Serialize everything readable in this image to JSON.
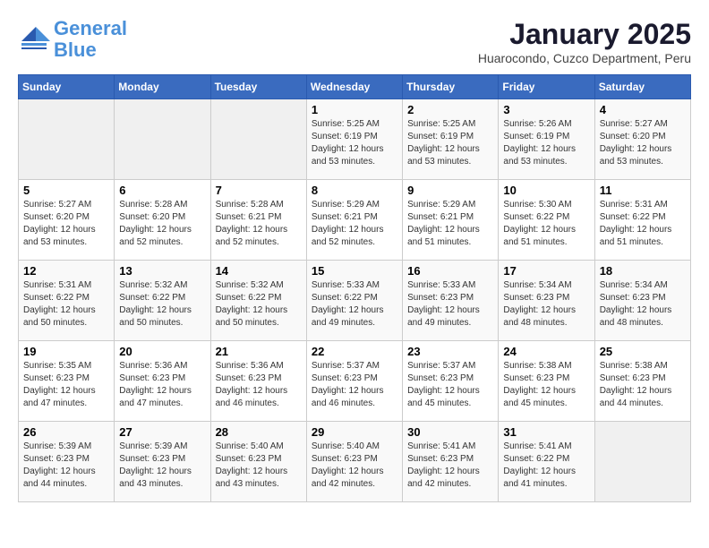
{
  "header": {
    "logo_line1": "General",
    "logo_line2": "Blue",
    "month_title": "January 2025",
    "subtitle": "Huarocondo, Cuzco Department, Peru"
  },
  "days_of_week": [
    "Sunday",
    "Monday",
    "Tuesday",
    "Wednesday",
    "Thursday",
    "Friday",
    "Saturday"
  ],
  "weeks": [
    [
      {
        "num": "",
        "info": ""
      },
      {
        "num": "",
        "info": ""
      },
      {
        "num": "",
        "info": ""
      },
      {
        "num": "1",
        "info": "Sunrise: 5:25 AM\nSunset: 6:19 PM\nDaylight: 12 hours\nand 53 minutes."
      },
      {
        "num": "2",
        "info": "Sunrise: 5:25 AM\nSunset: 6:19 PM\nDaylight: 12 hours\nand 53 minutes."
      },
      {
        "num": "3",
        "info": "Sunrise: 5:26 AM\nSunset: 6:19 PM\nDaylight: 12 hours\nand 53 minutes."
      },
      {
        "num": "4",
        "info": "Sunrise: 5:27 AM\nSunset: 6:20 PM\nDaylight: 12 hours\nand 53 minutes."
      }
    ],
    [
      {
        "num": "5",
        "info": "Sunrise: 5:27 AM\nSunset: 6:20 PM\nDaylight: 12 hours\nand 53 minutes."
      },
      {
        "num": "6",
        "info": "Sunrise: 5:28 AM\nSunset: 6:20 PM\nDaylight: 12 hours\nand 52 minutes."
      },
      {
        "num": "7",
        "info": "Sunrise: 5:28 AM\nSunset: 6:21 PM\nDaylight: 12 hours\nand 52 minutes."
      },
      {
        "num": "8",
        "info": "Sunrise: 5:29 AM\nSunset: 6:21 PM\nDaylight: 12 hours\nand 52 minutes."
      },
      {
        "num": "9",
        "info": "Sunrise: 5:29 AM\nSunset: 6:21 PM\nDaylight: 12 hours\nand 51 minutes."
      },
      {
        "num": "10",
        "info": "Sunrise: 5:30 AM\nSunset: 6:22 PM\nDaylight: 12 hours\nand 51 minutes."
      },
      {
        "num": "11",
        "info": "Sunrise: 5:31 AM\nSunset: 6:22 PM\nDaylight: 12 hours\nand 51 minutes."
      }
    ],
    [
      {
        "num": "12",
        "info": "Sunrise: 5:31 AM\nSunset: 6:22 PM\nDaylight: 12 hours\nand 50 minutes."
      },
      {
        "num": "13",
        "info": "Sunrise: 5:32 AM\nSunset: 6:22 PM\nDaylight: 12 hours\nand 50 minutes."
      },
      {
        "num": "14",
        "info": "Sunrise: 5:32 AM\nSunset: 6:22 PM\nDaylight: 12 hours\nand 50 minutes."
      },
      {
        "num": "15",
        "info": "Sunrise: 5:33 AM\nSunset: 6:22 PM\nDaylight: 12 hours\nand 49 minutes."
      },
      {
        "num": "16",
        "info": "Sunrise: 5:33 AM\nSunset: 6:23 PM\nDaylight: 12 hours\nand 49 minutes."
      },
      {
        "num": "17",
        "info": "Sunrise: 5:34 AM\nSunset: 6:23 PM\nDaylight: 12 hours\nand 48 minutes."
      },
      {
        "num": "18",
        "info": "Sunrise: 5:34 AM\nSunset: 6:23 PM\nDaylight: 12 hours\nand 48 minutes."
      }
    ],
    [
      {
        "num": "19",
        "info": "Sunrise: 5:35 AM\nSunset: 6:23 PM\nDaylight: 12 hours\nand 47 minutes."
      },
      {
        "num": "20",
        "info": "Sunrise: 5:36 AM\nSunset: 6:23 PM\nDaylight: 12 hours\nand 47 minutes."
      },
      {
        "num": "21",
        "info": "Sunrise: 5:36 AM\nSunset: 6:23 PM\nDaylight: 12 hours\nand 46 minutes."
      },
      {
        "num": "22",
        "info": "Sunrise: 5:37 AM\nSunset: 6:23 PM\nDaylight: 12 hours\nand 46 minutes."
      },
      {
        "num": "23",
        "info": "Sunrise: 5:37 AM\nSunset: 6:23 PM\nDaylight: 12 hours\nand 45 minutes."
      },
      {
        "num": "24",
        "info": "Sunrise: 5:38 AM\nSunset: 6:23 PM\nDaylight: 12 hours\nand 45 minutes."
      },
      {
        "num": "25",
        "info": "Sunrise: 5:38 AM\nSunset: 6:23 PM\nDaylight: 12 hours\nand 44 minutes."
      }
    ],
    [
      {
        "num": "26",
        "info": "Sunrise: 5:39 AM\nSunset: 6:23 PM\nDaylight: 12 hours\nand 44 minutes."
      },
      {
        "num": "27",
        "info": "Sunrise: 5:39 AM\nSunset: 6:23 PM\nDaylight: 12 hours\nand 43 minutes."
      },
      {
        "num": "28",
        "info": "Sunrise: 5:40 AM\nSunset: 6:23 PM\nDaylight: 12 hours\nand 43 minutes."
      },
      {
        "num": "29",
        "info": "Sunrise: 5:40 AM\nSunset: 6:23 PM\nDaylight: 12 hours\nand 42 minutes."
      },
      {
        "num": "30",
        "info": "Sunrise: 5:41 AM\nSunset: 6:23 PM\nDaylight: 12 hours\nand 42 minutes."
      },
      {
        "num": "31",
        "info": "Sunrise: 5:41 AM\nSunset: 6:22 PM\nDaylight: 12 hours\nand 41 minutes."
      },
      {
        "num": "",
        "info": ""
      }
    ]
  ]
}
